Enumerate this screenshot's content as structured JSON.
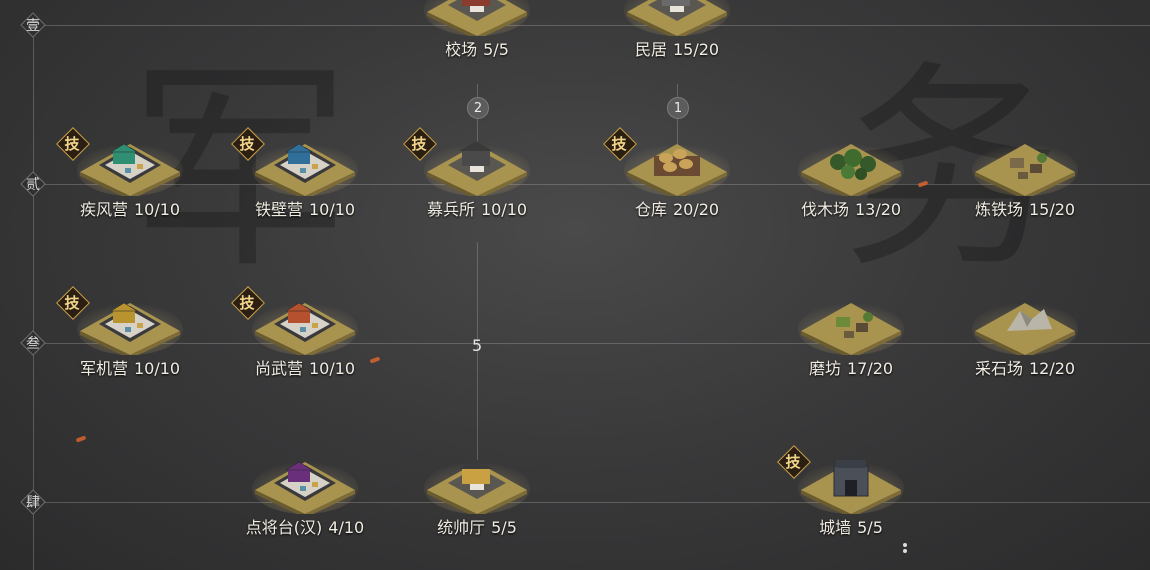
{
  "tiers": [
    {
      "label": "壹"
    },
    {
      "label": "贰"
    },
    {
      "label": "叁"
    },
    {
      "label": "肆"
    }
  ],
  "background_glyphs": [
    "军",
    "务"
  ],
  "tech_badge_label": "技",
  "buildings": [
    {
      "id": "jiaochang",
      "name": "校场",
      "count": "5/5",
      "tech": false,
      "kind": "compound",
      "roof": "#8a3c2e"
    },
    {
      "id": "minju",
      "name": "民居",
      "count": "15/20",
      "tech": false,
      "kind": "compound",
      "roof": "#6a6a6a"
    },
    {
      "id": "jifengying",
      "name": "疾风营",
      "count": "10/10",
      "tech": true,
      "kind": "barracks",
      "roof": "#2f8f73"
    },
    {
      "id": "tiebiying",
      "name": "铁壁营",
      "count": "10/10",
      "tech": true,
      "kind": "barracks",
      "roof": "#2f6f9a"
    },
    {
      "id": "mubingsuo",
      "name": "募兵所",
      "count": "10/10",
      "tech": true,
      "kind": "compound",
      "roof": "#4a4a4a"
    },
    {
      "id": "cangku",
      "name": "仓库",
      "count": "20/20",
      "tech": true,
      "kind": "warehouse",
      "roof": "#c9a35a"
    },
    {
      "id": "famuchang",
      "name": "伐木场",
      "count": "13/20",
      "tech": false,
      "kind": "forest",
      "roof": "#3f6b2e"
    },
    {
      "id": "liantiechang",
      "name": "炼铁场",
      "count": "15/20",
      "tech": false,
      "kind": "plain",
      "roof": "#7a6a4a"
    },
    {
      "id": "junjiying",
      "name": "军机营",
      "count": "10/10",
      "tech": true,
      "kind": "barracks",
      "roof": "#b8932e"
    },
    {
      "id": "shangwuying",
      "name": "尚武营",
      "count": "10/10",
      "tech": true,
      "kind": "barracks",
      "roof": "#b5512e"
    },
    {
      "id": "mofang",
      "name": "磨坊",
      "count": "17/20",
      "tech": false,
      "kind": "plain",
      "roof": "#6b8a3a"
    },
    {
      "id": "caishichang",
      "name": "采石场",
      "count": "12/20",
      "tech": false,
      "kind": "rock",
      "roof": "#8c8a80"
    },
    {
      "id": "dianjiangtai",
      "name": "点将台(汉)",
      "count": "4/10",
      "tech": false,
      "kind": "barracks",
      "roof": "#6a2f7a"
    },
    {
      "id": "tongshuaiting",
      "name": "统帅厅",
      "count": "5/5",
      "tech": false,
      "kind": "compound",
      "roof": "#c9a042"
    },
    {
      "id": "chengqiang",
      "name": "城墙",
      "count": "5/5",
      "tech": true,
      "kind": "wall",
      "roof": "#4a4f58"
    }
  ],
  "requirements": [
    {
      "id": "req-jiaochang",
      "value": "2"
    },
    {
      "id": "req-minju",
      "value": "1"
    },
    {
      "id": "req-mubingsuo",
      "value": "5"
    }
  ],
  "colors": {
    "label": "#f1ece2",
    "tech_badge_text": "#f3d58a",
    "tech_badge_border": "#c9a24a",
    "tile_ground": "#a9944f"
  }
}
